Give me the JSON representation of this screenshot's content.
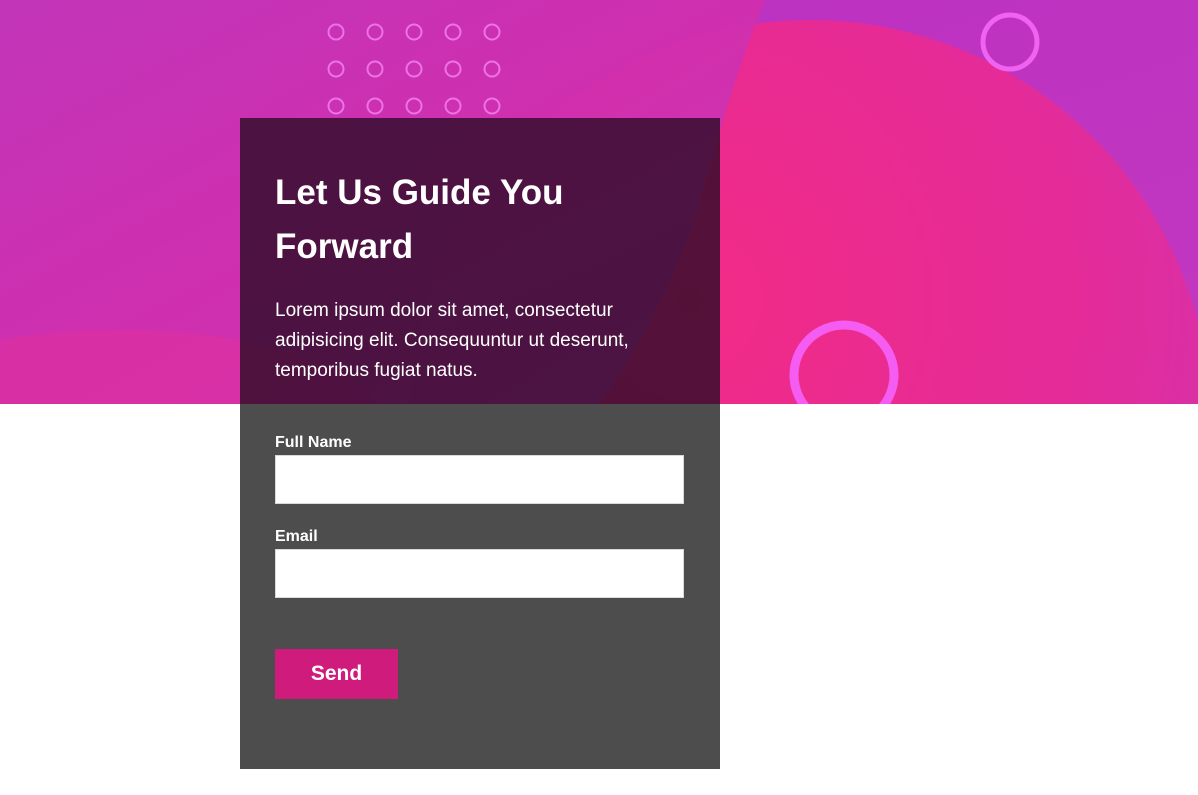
{
  "colors": {
    "hero_gradient_start": "#b52fbf",
    "hero_gradient_end": "#b93ac8",
    "hero_shape_pink": "#e8278a",
    "ring_color": "#f05cf0",
    "card_overlay": "#280a22",
    "form_panel": "#4d4d4d",
    "button_bg": "#cf1b7c",
    "text": "#ffffff"
  },
  "hero": {
    "decorations": [
      "dot-grid-decoration",
      "ring-icon",
      "ring-icon"
    ]
  },
  "card": {
    "title": "Let Us Guide You Forward",
    "description": "Lorem ipsum dolor sit amet, consectetur adipisicing elit. Consequuntur ut deserunt, temporibus fugiat natus."
  },
  "form": {
    "full_name": {
      "label": "Full Name",
      "value": "",
      "placeholder": ""
    },
    "email": {
      "label": "Email",
      "value": "",
      "placeholder": ""
    },
    "send_label": "Send"
  }
}
